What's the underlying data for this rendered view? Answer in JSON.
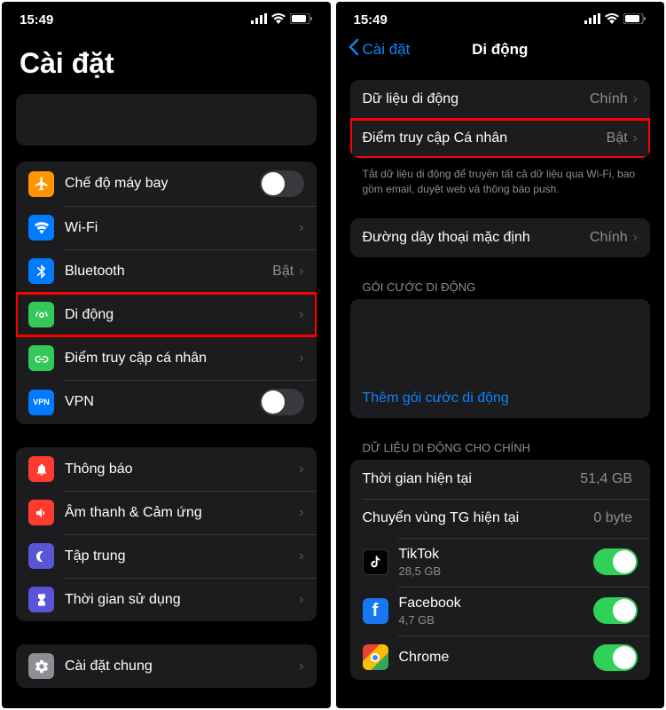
{
  "left": {
    "time": "15:49",
    "title": "Cài đặt",
    "rows": {
      "airplane": "Chế độ máy bay",
      "wifi": "Wi-Fi",
      "bluetooth": "Bluetooth",
      "bluetooth_value": "Bật",
      "cellular": "Di động",
      "hotspot": "Điểm truy cập cá nhân",
      "vpn": "VPN",
      "notifications": "Thông báo",
      "sounds": "Âm thanh & Cảm ứng",
      "focus": "Tập trung",
      "screentime": "Thời gian sử dụng",
      "general": "Cài đặt chung"
    }
  },
  "right": {
    "time": "15:49",
    "back": "Cài đặt",
    "title": "Di động",
    "rows": {
      "cellular_data": "Dữ liệu di động",
      "cellular_data_value": "Chính",
      "hotspot": "Điểm truy cập Cá nhân",
      "hotspot_value": "Bật",
      "footer": "Tắt dữ liệu di động để truyền tất cả dữ liệu qua Wi-Fi, bao gồm email, duyệt web và thông báo push.",
      "default_line": "Đường dây thoại mặc định",
      "default_line_value": "Chính",
      "plans_header": "GÓI CƯỚC DI ĐỘNG",
      "add_plan": "Thêm gói cước di động",
      "data_header": "DỮ LIỆU DI ĐỘNG CHO CHÍNH",
      "current_period": "Thời gian hiện tại",
      "current_period_value": "51,4 GB",
      "roaming": "Chuyển vùng TG hiện tại",
      "roaming_value": "0 byte",
      "tiktok": "TikTok",
      "tiktok_size": "28,5 GB",
      "facebook": "Facebook",
      "facebook_size": "4,7 GB",
      "chrome": "Chrome"
    }
  }
}
